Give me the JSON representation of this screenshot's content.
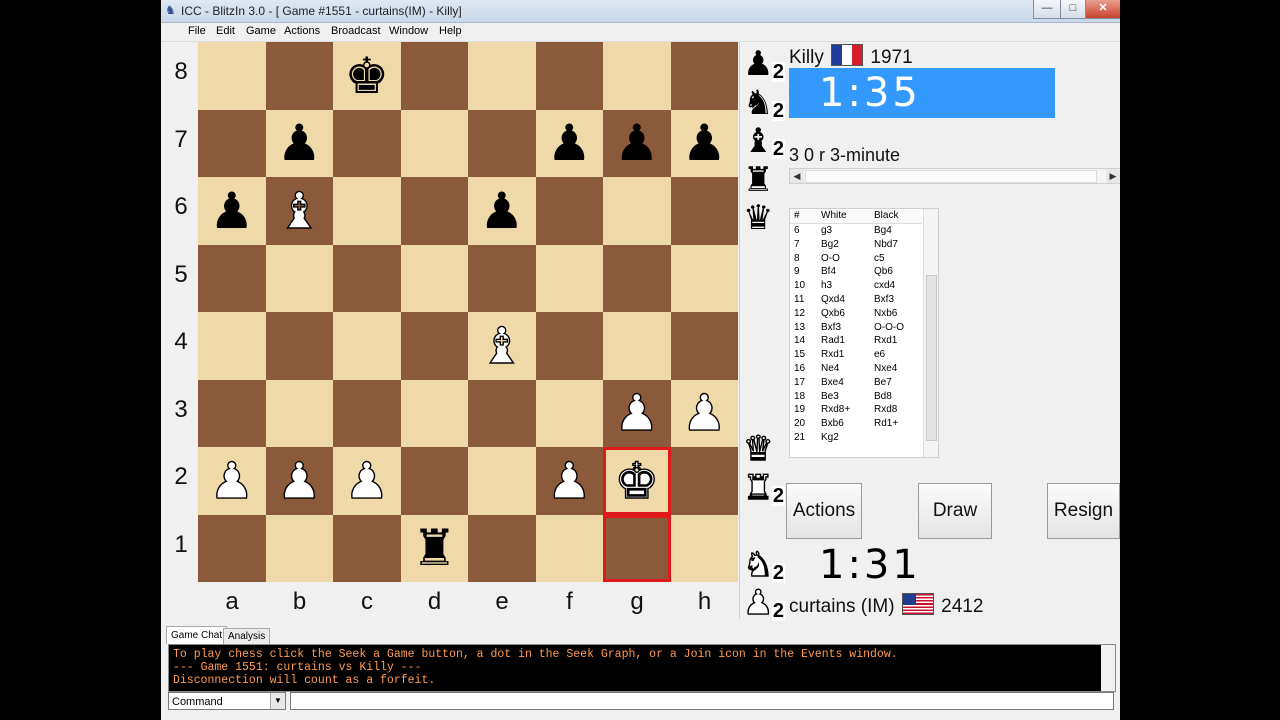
{
  "window": {
    "title": "ICC - BlitzIn 3.0 - [ Game #1551 - curtains(IM) - Killy]",
    "controls": {
      "minimize": "—",
      "maximize": "□",
      "close": "✕"
    }
  },
  "menu": [
    "File",
    "Edit",
    "Game",
    "Actions",
    "Broadcast",
    "Window",
    "Help"
  ],
  "board": {
    "ranks": [
      "8",
      "7",
      "6",
      "5",
      "4",
      "3",
      "2",
      "1"
    ],
    "files": [
      "a",
      "b",
      "c",
      "d",
      "e",
      "f",
      "g",
      "h"
    ],
    "light_color": "#f0d9a8",
    "dark_color": "#8b5a3a",
    "highlight_color": "#e0191b",
    "highlight": [
      "g2",
      "g1"
    ],
    "pieces": [
      {
        "square": "c8",
        "color": "black",
        "type": "king"
      },
      {
        "square": "b7",
        "color": "black",
        "type": "pawn"
      },
      {
        "square": "f7",
        "color": "black",
        "type": "pawn"
      },
      {
        "square": "g7",
        "color": "black",
        "type": "pawn"
      },
      {
        "square": "h7",
        "color": "black",
        "type": "pawn"
      },
      {
        "square": "a6",
        "color": "black",
        "type": "pawn"
      },
      {
        "square": "b6",
        "color": "white",
        "type": "bishop"
      },
      {
        "square": "e6",
        "color": "black",
        "type": "pawn"
      },
      {
        "square": "e4",
        "color": "white",
        "type": "bishop"
      },
      {
        "square": "g3",
        "color": "white",
        "type": "pawn"
      },
      {
        "square": "h3",
        "color": "white",
        "type": "pawn"
      },
      {
        "square": "a2",
        "color": "white",
        "type": "pawn"
      },
      {
        "square": "b2",
        "color": "white",
        "type": "pawn"
      },
      {
        "square": "c2",
        "color": "white",
        "type": "pawn"
      },
      {
        "square": "f2",
        "color": "white",
        "type": "pawn"
      },
      {
        "square": "g2",
        "color": "white",
        "type": "king"
      },
      {
        "square": "d1",
        "color": "black",
        "type": "rook"
      }
    ]
  },
  "captured": [
    {
      "color": "black",
      "type": "pawn",
      "count": "2",
      "slot": 0
    },
    {
      "color": "black",
      "type": "knight",
      "count": "2",
      "slot": 1
    },
    {
      "color": "black",
      "type": "bishop",
      "count": "2",
      "slot": 2
    },
    {
      "color": "black",
      "type": "rook",
      "count": "",
      "slot": 3
    },
    {
      "color": "black",
      "type": "queen",
      "count": "",
      "slot": 4
    },
    {
      "color": "white",
      "type": "queen",
      "count": "",
      "slot": 10
    },
    {
      "color": "white",
      "type": "rook",
      "count": "2",
      "slot": 11
    },
    {
      "color": "white",
      "type": "knight",
      "count": "2",
      "slot": 13
    },
    {
      "color": "white",
      "type": "pawn",
      "count": "2",
      "slot": 14
    }
  ],
  "top_player": {
    "name": "Killy",
    "rating": "1971",
    "flag": "france",
    "clock": "1:35"
  },
  "bottom_player": {
    "name": "curtains (IM)",
    "rating": "2412",
    "flag": "usa",
    "clock": "1:31"
  },
  "game_type": "3 0 r 3-minute",
  "moves": {
    "headers": [
      "#",
      "White",
      "Black"
    ],
    "rows": [
      [
        "6",
        "g3",
        "Bg4"
      ],
      [
        "7",
        "Bg2",
        "Nbd7"
      ],
      [
        "8",
        "O-O",
        "c5"
      ],
      [
        "9",
        "Bf4",
        "Qb6"
      ],
      [
        "10",
        "h3",
        "cxd4"
      ],
      [
        "11",
        "Qxd4",
        "Bxf3"
      ],
      [
        "12",
        "Qxb6",
        "Nxb6"
      ],
      [
        "13",
        "Bxf3",
        "O-O-O"
      ],
      [
        "14",
        "Rad1",
        "Rxd1"
      ],
      [
        "15",
        "Rxd1",
        "e6"
      ],
      [
        "16",
        "Ne4",
        "Nxe4"
      ],
      [
        "17",
        "Bxe4",
        "Be7"
      ],
      [
        "18",
        "Be3",
        "Bd8"
      ],
      [
        "19",
        "Rxd8+",
        "Rxd8"
      ],
      [
        "20",
        "Bxb6",
        "Rd1+"
      ],
      [
        "21",
        "Kg2",
        ""
      ]
    ]
  },
  "buttons": {
    "actions": "Actions",
    "draw": "Draw",
    "resign": "Resign"
  },
  "chat": {
    "tabs": [
      "Game Chat",
      "Analysis"
    ],
    "lines": [
      "To play chess click the Seek a Game button, a dot in the Seek Graph, or a Join icon in the Events window.",
      "--- Game 1551: curtains vs Killy ---",
      "Disconnection will count as a forfeit."
    ],
    "text_color": "#ff9a50",
    "command_mode": "Command",
    "input_value": ""
  },
  "glyphs": {
    "king": "♚",
    "queen": "♛",
    "rook": "♜",
    "bishop": "♝",
    "knight": "♞",
    "pawn": "♟"
  }
}
